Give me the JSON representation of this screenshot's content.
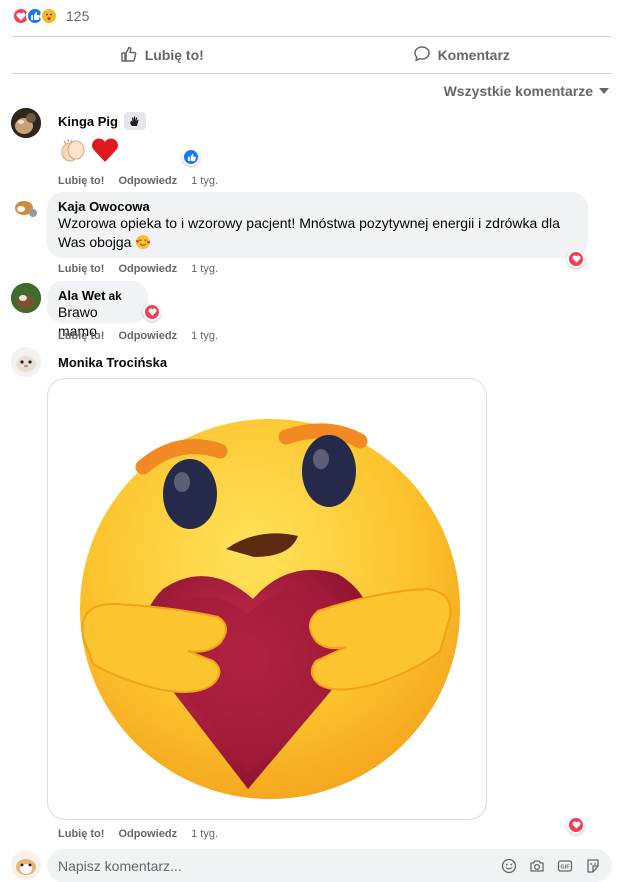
{
  "reactions": {
    "count": "125",
    "types": [
      "love-icon",
      "like-icon",
      "care-icon"
    ],
    "colors": {
      "love": "#f33e58",
      "like": "#1877f2",
      "care": "#f7b928"
    }
  },
  "actions": {
    "like_label": "Lubię to!",
    "comment_label": "Komentarz"
  },
  "filter": {
    "label": "Wszystkie komentarze"
  },
  "comments": [
    {
      "author": "Kinga Pig",
      "badge_icon": "waving-hand-icon",
      "body_icons": [
        "clapping-hands-emoji",
        "red-heart-emoji"
      ],
      "reaction_icon": "like-icon",
      "like_link": "Lubię to!",
      "reply_link": "Odpowiedz",
      "time": "1 tyg."
    },
    {
      "author": "Kaja Owocowa",
      "text": "Wzorowa opieka to i wzorowy pacjent! Mnóstwa pozytywnej energii i zdrówka dla Was obojga",
      "text_emoji": "smiling-face-with-hearts-emoji",
      "reaction_icon": "love-icon",
      "like_link": "Lubię to!",
      "reply_link": "Odpowiedz",
      "time": "1 tyg."
    },
    {
      "author": "Ala Wet",
      "author_suffix": "ak",
      "text": "Brawo mamo",
      "reaction_icon": "love-icon",
      "like_link": "Lubię to!",
      "reply_link": "Odpowiedz",
      "time": "1 tyg."
    },
    {
      "author": "Monika Trocińska",
      "attachment": "care-emoji-hugging-heart-sticker",
      "reaction_icon": "love-icon",
      "like_link": "Lubię to!",
      "reply_link": "Odpowiedz",
      "time": "1 tyg."
    }
  ],
  "composer": {
    "placeholder": "Napisz komentarz...",
    "icons": [
      "emoji-icon",
      "camera-icon",
      "gif-icon",
      "sticker-icon"
    ]
  }
}
